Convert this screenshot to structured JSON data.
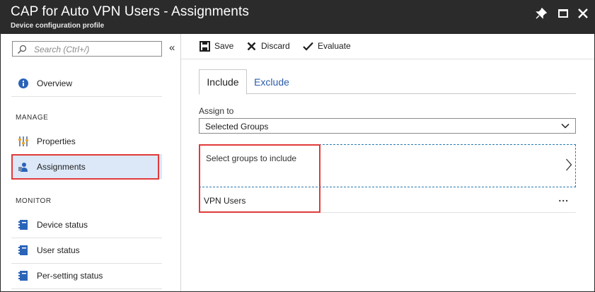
{
  "window": {
    "title": "CAP for Auto VPN Users - Assignments",
    "subtitle": "Device configuration profile",
    "pin_icon": "pin-icon",
    "maximize_icon": "maximize-icon",
    "close_icon": "close-icon"
  },
  "sidebar": {
    "search_placeholder": "Search (Ctrl+/)",
    "collapse_glyph": "«",
    "overview": {
      "label": "Overview",
      "icon": "info-icon"
    },
    "manage_header": "MANAGE",
    "manage_items": [
      {
        "label": "Properties",
        "icon": "properties-icon"
      },
      {
        "label": "Assignments",
        "icon": "assignments-icon",
        "selected": true
      }
    ],
    "monitor_header": "MONITOR",
    "monitor_items": [
      {
        "label": "Device status",
        "icon": "notebook-icon"
      },
      {
        "label": "User status",
        "icon": "notebook-icon"
      },
      {
        "label": "Per-setting status",
        "icon": "notebook-icon"
      }
    ]
  },
  "toolbar": {
    "save_label": "Save",
    "discard_label": "Discard",
    "evaluate_label": "Evaluate"
  },
  "tabs": {
    "include_label": "Include",
    "exclude_label": "Exclude",
    "active": "Include"
  },
  "assign": {
    "label": "Assign to",
    "selected_value": "Selected Groups"
  },
  "groups": {
    "select_text": "Select groups to include",
    "items": [
      {
        "name": "VPN Users",
        "more": "..."
      }
    ]
  },
  "colors": {
    "titlebar": "#2b2b2b",
    "accent": "#2a5cab",
    "selected_bg": "#dce8f8",
    "highlight": "#e13a3a"
  }
}
